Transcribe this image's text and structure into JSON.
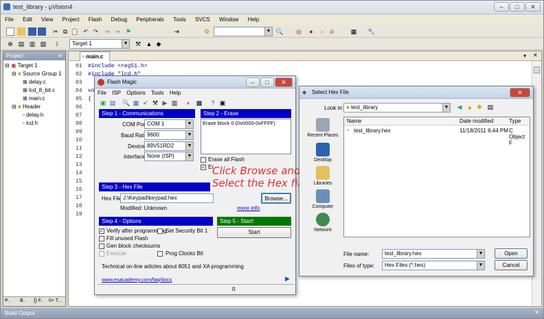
{
  "window": {
    "title": "test_library - µVision4"
  },
  "menu": [
    "File",
    "Edit",
    "View",
    "Project",
    "Flash",
    "Debug",
    "Peripherals",
    "Tools",
    "SVCS",
    "Window",
    "Help"
  ],
  "toolbar": {
    "target": "Target 1"
  },
  "project_panel": {
    "title": "Project",
    "tree": [
      "Target 1",
      "Source Group 1",
      "delay.c",
      "lcd_8_bit.c",
      "main.c",
      "Header",
      "delay.h",
      "lcd.h"
    ],
    "tabs": [
      "P..",
      "B..",
      "{} F..",
      "0+ T.."
    ]
  },
  "editor": {
    "tab": "main.c",
    "line_numbers": [
      "01",
      "02",
      "03",
      "04",
      "05",
      "06",
      "07",
      "08",
      "09",
      "10",
      "11",
      "12",
      "13",
      "14",
      "15",
      "16",
      "17",
      "18",
      "19"
    ],
    "visible_code": [
      "#include <reg51.h>",
      "#include \"lcd.h\"",
      "",
      "vo",
      "{"
    ]
  },
  "build_output": {
    "title": "Build Output"
  },
  "flash_magic": {
    "title": "Flash Magic",
    "menu": [
      "File",
      "ISP",
      "Options",
      "Tools",
      "Help"
    ],
    "step1": "Step 1 - Communications",
    "step2": "Step 2 - Erase",
    "com_port_label": "COM Port:",
    "com_port": "COM 1",
    "baud_label": "Baud Rate:",
    "baud": "9600",
    "device_label": "Device:",
    "device": "89V51RD2",
    "interface_label": "Interface:",
    "interface": "None (ISP)",
    "erase_block": "Erase block 0 (0x0000-0xFFFF)",
    "erase_all": "Erase all Flash",
    "erase_partial": "Er",
    "step3": "Step 3 - Hex File",
    "hex_label": "Hex File:",
    "hex_path": "J:\\Keypad\\keypad.hex",
    "browse": "Browse...",
    "modified": "Modified: Unknown",
    "more_info": "more info",
    "step4": "Step 4 - Options",
    "step5": "Step 5 - Start!",
    "opt_verify": "Verify after programming",
    "opt_security": "Set Security Bit 1",
    "opt_fill": "Fill unused Flash",
    "opt_checksums": "Gen block checksums",
    "opt_execute": "Execute",
    "opt_prog_clocks": "Prog Clocks Bit",
    "start": "Start",
    "info_text": "Technical on-line articles about 8051 and XA programming",
    "link": "www.esacademy.com/faq/docs",
    "status": "0"
  },
  "annotation": {
    "line1": "Click Browse and",
    "line2": "Select the Hex file"
  },
  "select_hex": {
    "title": "Select Hex File",
    "look_in_label": "Look in:",
    "look_in": "test_library",
    "places": [
      "Recent Places",
      "Desktop",
      "Libraries",
      "Computer",
      "Network"
    ],
    "columns": [
      "Name",
      "Date modified",
      "Type"
    ],
    "files": [
      {
        "name": "test_library.hex",
        "date": "11/18/2011 6:44 PM",
        "type": "C Object F"
      }
    ],
    "file_name_label": "File name:",
    "file_name": "test_library.hex",
    "file_type_label": "Files of type:",
    "file_type": "Hex Files (*.hex)",
    "open": "Open",
    "cancel": "Cancel"
  }
}
